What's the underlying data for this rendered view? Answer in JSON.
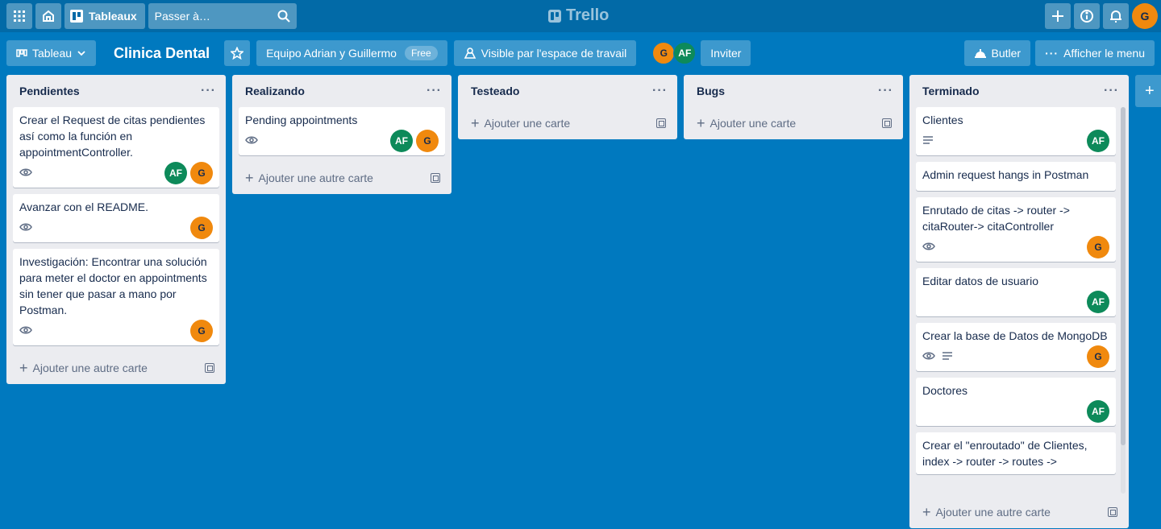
{
  "topbar": {
    "boards_label": "Tableaux",
    "search_placeholder": "Passer à…",
    "logo": "Trello",
    "user_initial": "G"
  },
  "board": {
    "view_label": "Tableau",
    "title": "Clinica Dental",
    "team": "Equipo Adrian y Guillermo",
    "team_badge": "Free",
    "visibility": "Visible par l'espace de travail",
    "members": [
      "G",
      "AF"
    ],
    "invite": "Inviter",
    "butler": "Butler",
    "menu": "Afficher le menu"
  },
  "lists": [
    {
      "name": "Pendientes",
      "add_label": "Ajouter une autre carte",
      "cards": [
        {
          "title": "Crear el Request de citas pendientes así como la función en appointmentController.",
          "watch": true,
          "members": [
            "AF",
            "G"
          ]
        },
        {
          "title": "Avanzar con el README.",
          "watch": true,
          "members": [
            "G"
          ]
        },
        {
          "title": "Investigación: Encontrar una solución para meter el doctor en appointments sin tener que pasar a mano por Postman.",
          "watch": true,
          "members": [
            "G"
          ]
        }
      ]
    },
    {
      "name": "Realizando",
      "add_label": "Ajouter une autre carte",
      "cards": [
        {
          "title": "Pending appointments",
          "watch": true,
          "members": [
            "AF",
            "G"
          ]
        }
      ]
    },
    {
      "name": "Testeado",
      "add_label": "Ajouter une carte",
      "cards": []
    },
    {
      "name": "Bugs",
      "add_label": "Ajouter une carte",
      "cards": []
    },
    {
      "name": "Terminado",
      "add_label": "Ajouter une autre carte",
      "cards": [
        {
          "title": "Clientes",
          "description": true,
          "members": [
            "AF"
          ]
        },
        {
          "title": "Admin request hangs in Postman",
          "members": []
        },
        {
          "title": "Enrutado de citas -> router -> citaRouter-> citaController",
          "watch": true,
          "members": [
            "G"
          ]
        },
        {
          "title": "Editar datos de usuario",
          "members": [
            "AF"
          ]
        },
        {
          "title": "Crear la base de Datos de MongoDB",
          "watch": true,
          "description": true,
          "members": [
            "G"
          ]
        },
        {
          "title": "Doctores",
          "members": [
            "AF"
          ]
        },
        {
          "title": "Crear el \"enroutado\" de Clientes, index -> router -> routes ->",
          "members": []
        }
      ]
    }
  ]
}
